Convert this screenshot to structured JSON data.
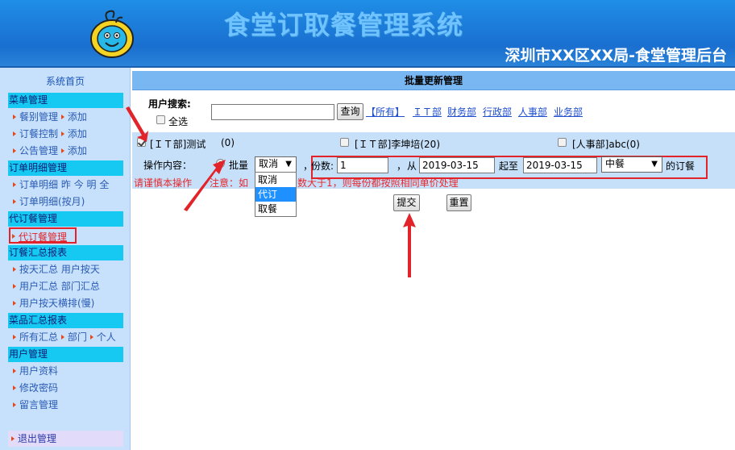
{
  "header": {
    "title": "食堂订取餐管理系统",
    "org": "深圳市XX区XX局-食堂管理后台"
  },
  "sidebar": {
    "home": "系统首页",
    "sections": [
      {
        "title": "菜单管理"
      },
      {
        "title": "订单明细管理"
      },
      {
        "title": "代订餐管理"
      },
      {
        "title": "订餐汇总报表"
      },
      {
        "title": "菜品汇总报表"
      },
      {
        "title": "用户管理"
      }
    ],
    "items": {
      "menu_category": "餐别管理",
      "menu_category_add": "添加",
      "order_control": "订餐控制",
      "order_control_add": "添加",
      "notice": "公告管理",
      "notice_add": "添加",
      "order_detail": "订单明细",
      "yesterday": "昨",
      "today": "今",
      "tomorrow": "明",
      "all": "全",
      "order_detail_month": "订单明细(按月)",
      "proxy_order": "代订餐管理",
      "summary_by_day": "按天汇总",
      "user_by_day": "用户按天",
      "user_summary": "用户汇总",
      "dept_summary": "部门汇总",
      "user_by_day_h": "用户按天横排(慢)",
      "all_summary": "所有汇总",
      "dept": "部门",
      "personal": "个人",
      "user_info": "用户资料",
      "change_pwd": "修改密码",
      "messages": "留言管理",
      "logout": "退出管理"
    }
  },
  "main": {
    "title": "批量更新管理",
    "search_label": "用户搜索:",
    "select_all": "全选",
    "search_value": "",
    "query_btn": "查询",
    "depts": [
      "【所有】",
      "ＩＴ部",
      "财务部",
      "行政部",
      "人事部",
      "业务部"
    ],
    "users": [
      {
        "label": "[ＩＴ部]测试",
        "count": "(0)",
        "checked": true
      },
      {
        "label": "[ＩＴ部]李坤培(20)",
        "checked": false
      },
      {
        "label": "[人事部]abc(0)",
        "checked": false
      }
    ],
    "op_label": "操作内容：",
    "batch_label": "批量",
    "batch_selected": "取消",
    "batch_options": [
      "取消",
      "代订",
      "取餐"
    ],
    "batch_highlight": "代订",
    "sep1": "，",
    "copies_label": "份数:",
    "copies_value": "1",
    "sep2": "，",
    "from_label": "从",
    "date_from": "2019-03-15",
    "to_label": "起至",
    "date_to": "2019-03-15",
    "meal_selected": "中餐",
    "suffix": "的订餐",
    "warning": "请谨慎本操作",
    "note_a": "注意：如",
    "note_b": "数大于1，则每份都按照相同单价处理",
    "submit_btn": "提交",
    "reset_btn": "重置"
  },
  "colors": {
    "header_blue": "#1a6fcf",
    "section_cyan": "#15c9f3",
    "annotation_red": "#e2232a"
  }
}
